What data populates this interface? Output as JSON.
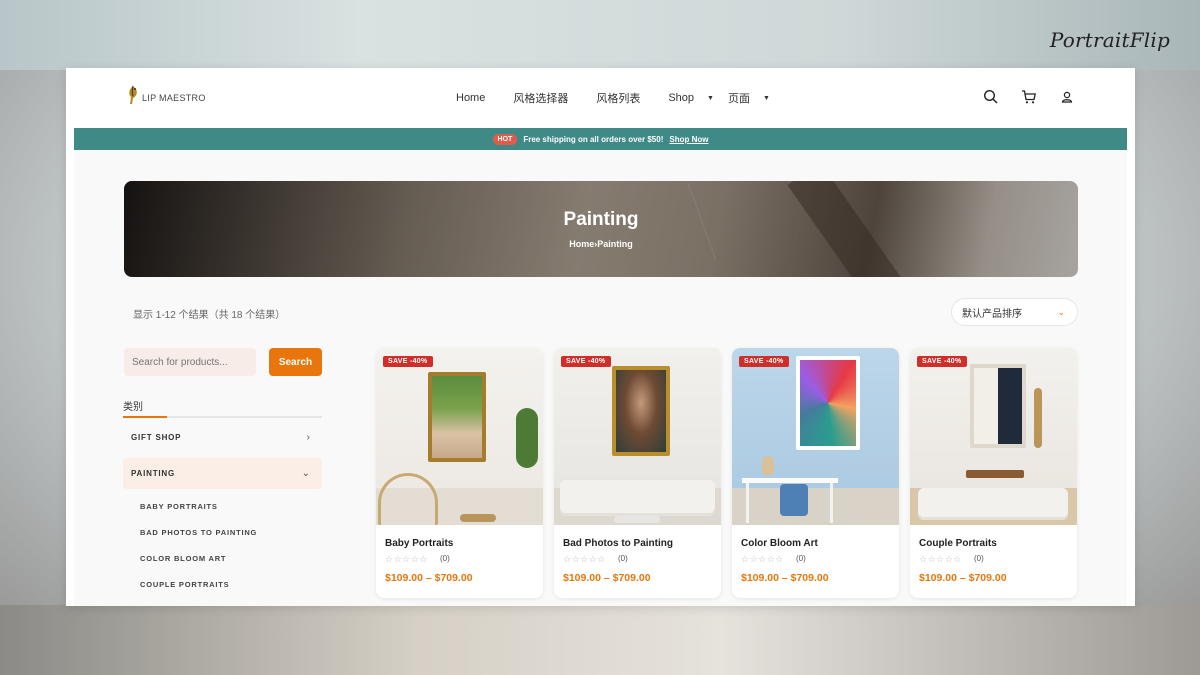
{
  "brand": {
    "watermark": "PortraitFlip"
  },
  "site": {
    "logo_text": "LIP MAESTRO"
  },
  "nav": {
    "items": [
      "Home",
      "风格选择器",
      "风格列表",
      "Shop",
      "页面"
    ]
  },
  "promo": {
    "badge": "HOT",
    "message": "Free shipping on all orders over $50!",
    "link": "Shop Now"
  },
  "hero": {
    "title": "Painting",
    "crumb_home": "Home",
    "crumb_sep": "›",
    "crumb_current": "Painting"
  },
  "results": {
    "count_text": "显示 1-12 个结果（共 18 个结果）",
    "sort_label": "默认产品排序"
  },
  "search": {
    "placeholder": "Search for products...",
    "button": "Search"
  },
  "categories": {
    "heading": "类别",
    "items": [
      {
        "label": "GIFT SHOP"
      },
      {
        "label": "PAINTING"
      }
    ],
    "sub_items": [
      "BABY PORTRAITS",
      "BAD PHOTOS TO PAINTING",
      "COLOR BLOOM ART",
      "COUPLE PORTRAITS"
    ]
  },
  "products": [
    {
      "badge": "SAVE -40%",
      "name": "Baby Portraits",
      "stars": "☆☆☆☆☆",
      "rating_count": "(0)",
      "price": "$109.00 – $709.00"
    },
    {
      "badge": "SAVE -40%",
      "name": "Bad Photos to Painting",
      "stars": "☆☆☆☆☆",
      "rating_count": "(0)",
      "price": "$109.00 – $709.00"
    },
    {
      "badge": "SAVE -40%",
      "name": "Color Bloom Art",
      "stars": "☆☆☆☆☆",
      "rating_count": "(0)",
      "price": "$109.00 – $709.00"
    },
    {
      "badge": "SAVE -40%",
      "name": "Couple Portraits",
      "stars": "☆☆☆☆☆",
      "rating_count": "(0)",
      "price": "$109.00 – $709.00"
    }
  ],
  "icons": {
    "search": "search-icon",
    "cart": "cart-icon",
    "account": "user-icon"
  },
  "colors": {
    "accent": "#e8760c",
    "promo_bar": "#3f8a87",
    "sale_badge": "#d12e2a"
  }
}
